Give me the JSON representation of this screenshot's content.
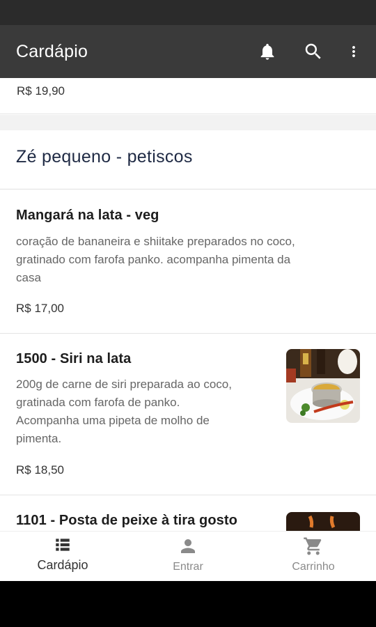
{
  "app_bar": {
    "title": "Cardápio",
    "icons": [
      "bell-icon",
      "search-icon",
      "more-vert-icon"
    ]
  },
  "previous_item": {
    "price": "R$ 19,90"
  },
  "section": {
    "title": "Zé pequeno - petiscos"
  },
  "products": [
    {
      "name": "Mangará na lata  - veg",
      "description": "coração de bananeira e shiitake preparados no coco, gratinado com farofa panko. acompanha pimenta da casa",
      "description_lines": [
        "coração de bananeira e shiitake preparados no coco,",
        "gratinado com farofa panko. acompanha pimenta da",
        "casa"
      ],
      "price": "R$ 17,00",
      "has_image": false
    },
    {
      "name": "1500 - Siri na lata",
      "description_lines": [
        "200g de carne de siri preparada ao coco,",
        "gratinada com farofa de panko.",
        "Acompanha uma pipeta de molho de",
        "pimenta."
      ],
      "price": "R$ 18,50",
      "has_image": true
    },
    {
      "name": "1101 - Posta de peixe à tira gosto",
      "has_image": true
    }
  ],
  "bottom_nav": [
    {
      "label": "Cardápio",
      "icon": "list-icon",
      "active": true
    },
    {
      "label": "Entrar",
      "icon": "person-icon",
      "active": false
    },
    {
      "label": "Carrinho",
      "icon": "cart-icon",
      "active": false
    }
  ],
  "colors": {
    "app_bar": "#3a3a3a",
    "status_bar": "#2b2b2b",
    "section_title": "#1f2a44",
    "inactive_nav": "#8a8a8a"
  }
}
